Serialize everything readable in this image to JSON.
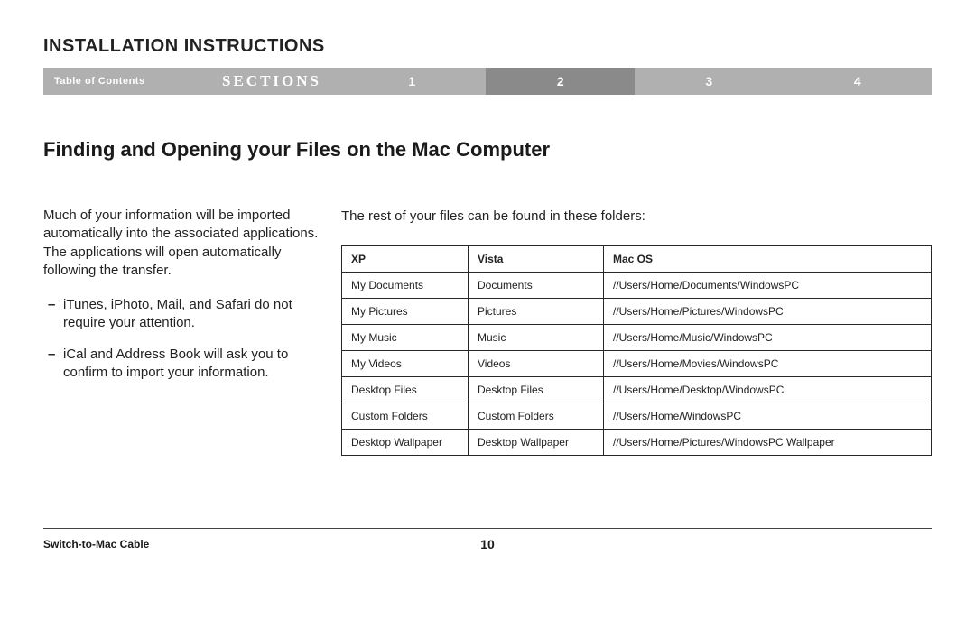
{
  "header": {
    "doc_title": "INSTALLATION INSTRUCTIONS",
    "toc_label": "Table of Contents",
    "sections_label": "SECTIONS",
    "tabs": [
      "1",
      "2",
      "3",
      "4"
    ],
    "active_tab_index": 1
  },
  "main": {
    "heading": "Finding and Opening your Files on the Mac Computer",
    "intro": "Much of your information will be imported automatically into the associated applications. The applications will open automatically following the transfer.",
    "bullets": [
      "iTunes, iPhoto, Mail, and Safari do not require your attention.",
      "iCal and Address Book will ask you to confirm to import your information."
    ],
    "table_caption": "The rest of your files can be found in these folders:",
    "table": {
      "headers": [
        "XP",
        "Vista",
        "Mac OS"
      ],
      "rows": [
        [
          "My Documents",
          "Documents",
          "//Users/Home/Documents/WindowsPC"
        ],
        [
          "My Pictures",
          "Pictures",
          "//Users/Home/Pictures/WindowsPC"
        ],
        [
          "My Music",
          "Music",
          "//Users/Home/Music/WindowsPC"
        ],
        [
          "My Videos",
          "Videos",
          "//Users/Home/Movies/WindowsPC"
        ],
        [
          "Desktop Files",
          "Desktop Files",
          "//Users/Home/Desktop/WindowsPC"
        ],
        [
          "Custom Folders",
          "Custom Folders",
          "//Users/Home/WindowsPC"
        ],
        [
          "Desktop Wallpaper",
          "Desktop Wallpaper",
          "//Users/Home/Pictures/WindowsPC Wallpaper"
        ]
      ]
    }
  },
  "footer": {
    "product": "Switch-to-Mac Cable",
    "page_number": "10"
  }
}
